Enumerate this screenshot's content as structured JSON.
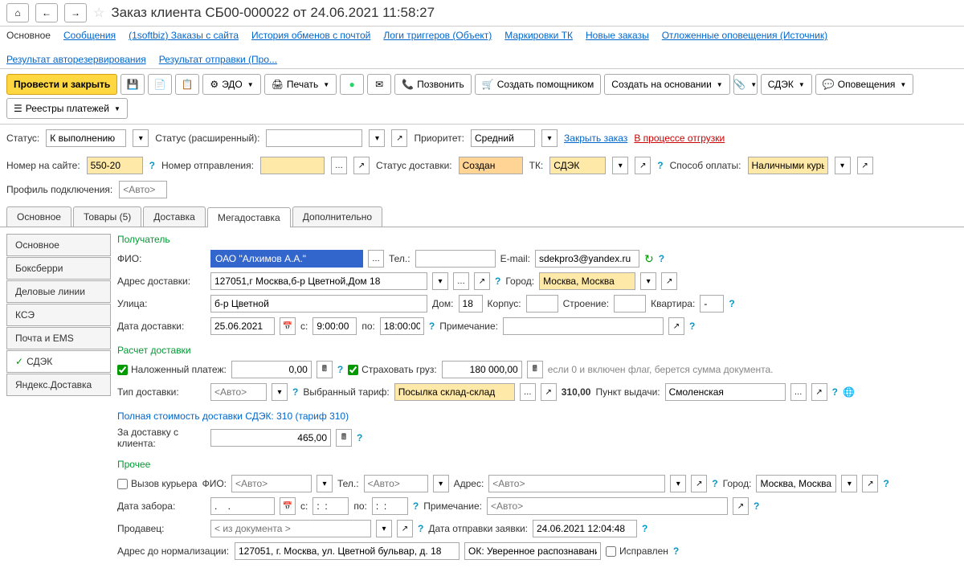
{
  "header": {
    "title": "Заказ клиента СБ00-000022 от 24.06.2021 11:58:27"
  },
  "links": {
    "main": "Основное",
    "messages": "Сообщения",
    "orders": "(1softbiz) Заказы с сайта",
    "mail_history": "История обменов с почтой",
    "triggers": "Логи триггеров (Объект)",
    "marking": "Маркировки ТК",
    "new_orders": "Новые заказы",
    "notifications": "Отложенные оповещения (Источник)",
    "autoreserve": "Результат авторезервирования",
    "send_result": "Результат отправки (Про..."
  },
  "toolbar": {
    "submit": "Провести и закрыть",
    "edo": "ЭДО",
    "print": "Печать",
    "call": "Позвонить",
    "create_helper": "Создать помощником",
    "create_based": "Создать на основании",
    "cdek": "СДЭК",
    "notifications": "Оповещения",
    "registry": "Реестры платежей"
  },
  "filters": {
    "status_label": "Статус:",
    "status_value": "К выполнению",
    "status_ext_label": "Статус (расширенный):",
    "priority_label": "Приоритет:",
    "priority_value": "Средний",
    "close_order": "Закрыть заказ",
    "in_progress": "В процессе отгрузки",
    "site_number_label": "Номер на сайте:",
    "site_number_value": "550-20",
    "shipment_label": "Номер отправления:",
    "delivery_status_label": "Статус доставки:",
    "delivery_status_value": "Создан",
    "tk_label": "ТК:",
    "tk_value": "СДЭК",
    "payment_label": "Способ оплаты:",
    "payment_value": "Наличными курье",
    "profile_label": "Профиль подключения:",
    "profile_placeholder": "<Авто>"
  },
  "tabs": [
    "Основное",
    "Товары (5)",
    "Доставка",
    "Мегадоставка",
    "Дополнительно"
  ],
  "sidebar_tabs": [
    "Основное",
    "Боксберри",
    "Деловые линии",
    "КСЭ",
    "Почта и EMS",
    "СДЭК",
    "Яндекс.Доставка"
  ],
  "recipient": {
    "title": "Получатель",
    "fio_label": "ФИО:",
    "fio_value": "ОАО \"Алхимов А.А.\"",
    "tel_label": "Тел.:",
    "email_label": "E-mail:",
    "email_value": "sdekpro3@yandex.ru",
    "address_label": "Адрес доставки:",
    "address_value": "127051,г Москва,б-р Цветной,Дом 18",
    "city_label": "Город:",
    "city_value": "Москва, Москва",
    "street_label": "Улица:",
    "street_value": "б-р Цветной",
    "house_label": "Дом:",
    "house_value": "18",
    "korpus_label": "Корпус:",
    "building_label": "Строение:",
    "flat_label": "Квартира:",
    "flat_value": "-",
    "date_label": "Дата доставки:",
    "date_value": "25.06.2021",
    "from_label": "с:",
    "from_value": "9:00:00",
    "to_label": "по:",
    "to_value": "18:00:00",
    "note_label": "Примечание:"
  },
  "calc": {
    "title": "Расчет доставки",
    "cod_label": "Наложенный платеж:",
    "cod_value": "0,00",
    "insure_label": "Страховать груз:",
    "insure_value": "180 000,00",
    "insure_hint": "если 0 и включен флаг, берется сумма документа.",
    "type_label": "Тип доставки:",
    "type_placeholder": "<Авто>",
    "tariff_label": "Выбранный тариф:",
    "tariff_value": "Посылка склад-склад",
    "tariff_price": "310,00",
    "point_label": "Пункт выдачи:",
    "point_value": "Смоленская"
  },
  "cost": {
    "title": "Полная стоимость доставки СДЭК: 310 (тариф 310)",
    "delivery_label": "За доставку с клиента:",
    "delivery_value": "465,00"
  },
  "other": {
    "title": "Прочее",
    "courier_label": "Вызов курьера",
    "fio_label": "ФИО:",
    "tel_label": "Тел.:",
    "address_label": "Адрес:",
    "city_label": "Город:",
    "city_value": "Москва, Москва",
    "auto_placeholder": "<Авто>",
    "pickup_date_label": "Дата забора:",
    "pickup_date_value": ".    .",
    "from_label": "с:",
    "from_value": ":  :",
    "to_label": "по:",
    "to_value": ":  :",
    "note_label": "Примечание:",
    "seller_label": "Продавец:",
    "seller_placeholder": "< из документа >",
    "request_date_label": "Дата отправки заявки:",
    "request_date_value": "24.06.2021 12:04:48",
    "norm_address_label": "Адрес до нормализации:",
    "norm_address_value": "127051, г. Москва, ул. Цветной бульвар, д. 18",
    "ok_label": "ОК: Уверенное распознавание",
    "fixed_label": "Исправлен"
  }
}
